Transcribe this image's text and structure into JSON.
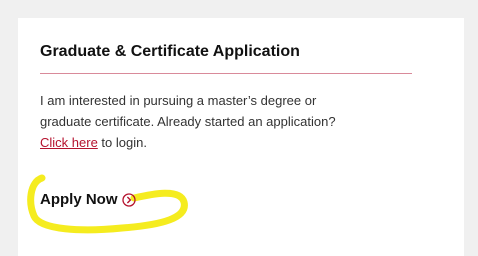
{
  "card": {
    "title": "Graduate & Certificate Application",
    "body_line_1": "I am interested in pursuing a master’s degree or",
    "body_line_2": "graduate certificate. Already started an application?",
    "login_link": "Click here",
    "login_suffix": " to login.",
    "cta_label": "Apply Now",
    "cta_icon": "chevron-right-circle-icon"
  },
  "colors": {
    "accent": "#b5122e",
    "divider": "#d98a9a",
    "highlight": "#f5ec1f"
  }
}
